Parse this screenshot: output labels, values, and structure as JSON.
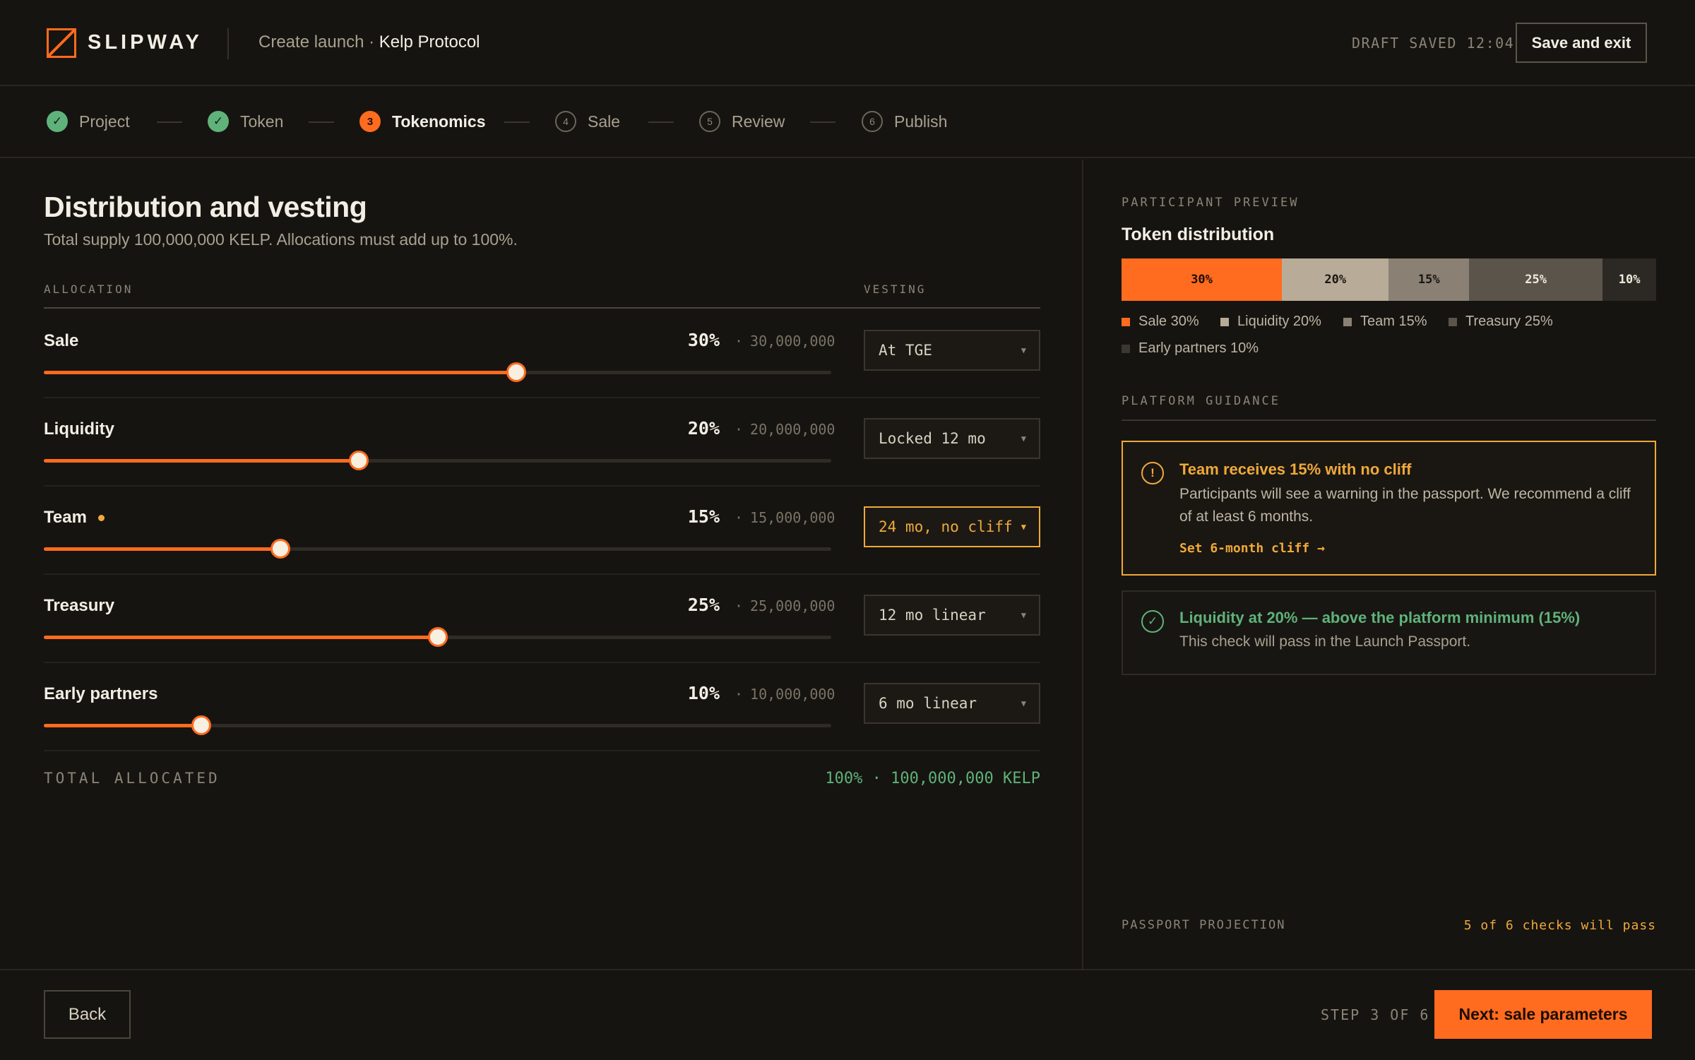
{
  "app": {
    "logo_text": "SLIPWAY",
    "breadcrumb_prefix": "Create launch",
    "breadcrumb_sep": " · ",
    "breadcrumb_current": "Kelp Protocol",
    "draft_status": "DRAFT SAVED 12:04",
    "save_exit_label": "Save and exit",
    "accent": "#ff6b1f"
  },
  "stepper": {
    "steps": [
      {
        "label": "Project",
        "state": "done",
        "marker": "✓"
      },
      {
        "label": "Token",
        "state": "done",
        "marker": "✓"
      },
      {
        "label": "Tokenomics",
        "state": "active",
        "marker": "3"
      },
      {
        "label": "Sale",
        "state": "todo",
        "marker": "4"
      },
      {
        "label": "Review",
        "state": "todo",
        "marker": "5"
      },
      {
        "label": "Publish",
        "state": "todo",
        "marker": "6"
      }
    ]
  },
  "main": {
    "title": "Distribution and vesting",
    "subtitle": "Total supply 100,000,000 KELP. Allocations must add up to 100%.",
    "col_allocation": "ALLOCATION",
    "col_vesting": "VESTING",
    "allocations": [
      {
        "name": "Sale",
        "pct_label": "30%",
        "amount": "30,000,000",
        "value": 30,
        "vesting": "At TGE",
        "warning": false
      },
      {
        "name": "Liquidity",
        "pct_label": "20%",
        "amount": "20,000,000",
        "value": 20,
        "vesting": "Locked 12 mo",
        "warning": false
      },
      {
        "name": "Team",
        "pct_label": "15%",
        "amount": "15,000,000",
        "value": 15,
        "vesting": "24 mo, no cliff",
        "warning": true
      },
      {
        "name": "Treasury",
        "pct_label": "25%",
        "amount": "25,000,000",
        "value": 25,
        "vesting": "12 mo linear",
        "warning": false
      },
      {
        "name": "Early partners",
        "pct_label": "10%",
        "amount": "10,000,000",
        "value": 10,
        "vesting": "6 mo linear",
        "warning": false
      }
    ],
    "slider_max": 50,
    "amount_sep": "·",
    "total_label": "TOTAL ALLOCATED",
    "total_value": "100% · 100,000,000 KELP"
  },
  "preview": {
    "eyebrow": "PARTICIPANT PREVIEW",
    "title": "Token distribution",
    "segments": [
      {
        "label": "30%",
        "legend": "Sale 30%",
        "value": 30,
        "color": "#ff6b1f",
        "text_color": "#1a0d04"
      },
      {
        "label": "20%",
        "legend": "Liquidity 20%",
        "value": 20,
        "color": "#b8ab97",
        "text_color": "#1a1712"
      },
      {
        "label": "15%",
        "legend": "Team 15%",
        "value": 15,
        "color": "#8a8174",
        "text_color": "#1a1712"
      },
      {
        "label": "25%",
        "legend": "Treasury 25%",
        "value": 25,
        "color": "#5a544b",
        "text_color": "#efe9dc"
      },
      {
        "label": "10%",
        "legend": "Early partners 10%",
        "value": 10,
        "color": "#2c2924",
        "text_color": "#efe9dc"
      }
    ],
    "guidance_eyebrow": "PLATFORM GUIDANCE",
    "alert": {
      "icon": "!",
      "title": "Team receives 15% with no cliff",
      "body": "Participants will see a warning in the passport. We recommend a cliff of at least 6 months.",
      "link": "Set 6-month cliff →"
    },
    "ok": {
      "icon": "✓",
      "title": "Liquidity at 20% — above the platform minimum (15%)",
      "body": "This check will pass in the Launch Passport."
    },
    "passport_label": "PASSPORT PROJECTION",
    "passport_value": "5 of 6 checks will pass"
  },
  "footer": {
    "back_label": "Back",
    "step_counter": "STEP 3 OF 6",
    "next_label": "Next: sale parameters"
  }
}
